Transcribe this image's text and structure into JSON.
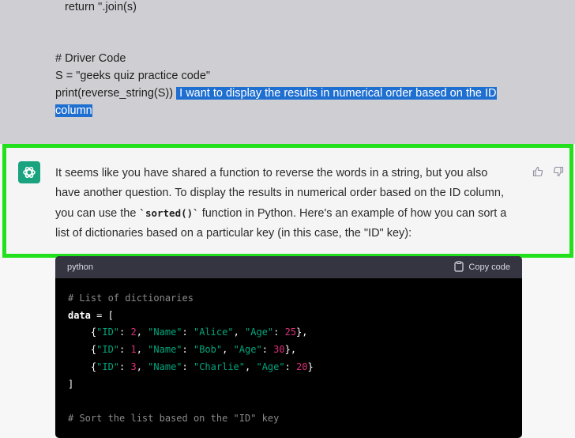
{
  "user_message": {
    "lines": [
      "return ''.join(s)",
      "# Driver Code",
      "S = \"geeks quiz practice code\"",
      "print(reverse_string(S))",
      "I want to display the results in numerical order based on the ID",
      "column"
    ]
  },
  "assistant_message": {
    "text_before": "It seems like you have shared a function to reverse the words in a string, but you also have another question. To display the results in numerical order based on the ID column, you can use the ",
    "inline_code": "`sorted()`",
    "text_after": " function in Python. Here's an example of how you can sort a list of dictionaries based on a particular key (in this case, the \"ID\" key):",
    "icons": {
      "avatar": "chatgpt-logo-icon",
      "like": "thumbs-up-icon",
      "dislike": "thumbs-down-icon"
    }
  },
  "code_block": {
    "language": "python",
    "copy_label": "Copy code",
    "copy_icon": "clipboard-icon",
    "comment_1": "# List of dictionaries",
    "var_name": "data",
    "op_open": " = [",
    "rows": [
      {
        "id_key": "\"ID\"",
        "id_val": "2",
        "name_key": "\"Name\"",
        "name_val": "\"Alice\"",
        "age_key": "\"Age\"",
        "age_val": "25",
        "trail": "},"
      },
      {
        "id_key": "\"ID\"",
        "id_val": "1",
        "name_key": "\"Name\"",
        "name_val": "\"Bob\"",
        "age_key": "\"Age\"",
        "age_val": "30",
        "trail": "},"
      },
      {
        "id_key": "\"ID\"",
        "id_val": "3",
        "name_key": "\"Name\"",
        "name_val": "\"Charlie\"",
        "age_key": "\"Age\"",
        "age_val": "20",
        "trail": "}"
      }
    ],
    "close_bracket": "]",
    "comment_2": "# Sort the list based on the \"ID\" key"
  },
  "colors": {
    "highlight_frame": "#22e01c",
    "selection": "#1f6fd1",
    "avatar_bg": "#19a37f",
    "code_string": "#00a67d",
    "code_number": "#df3079"
  }
}
